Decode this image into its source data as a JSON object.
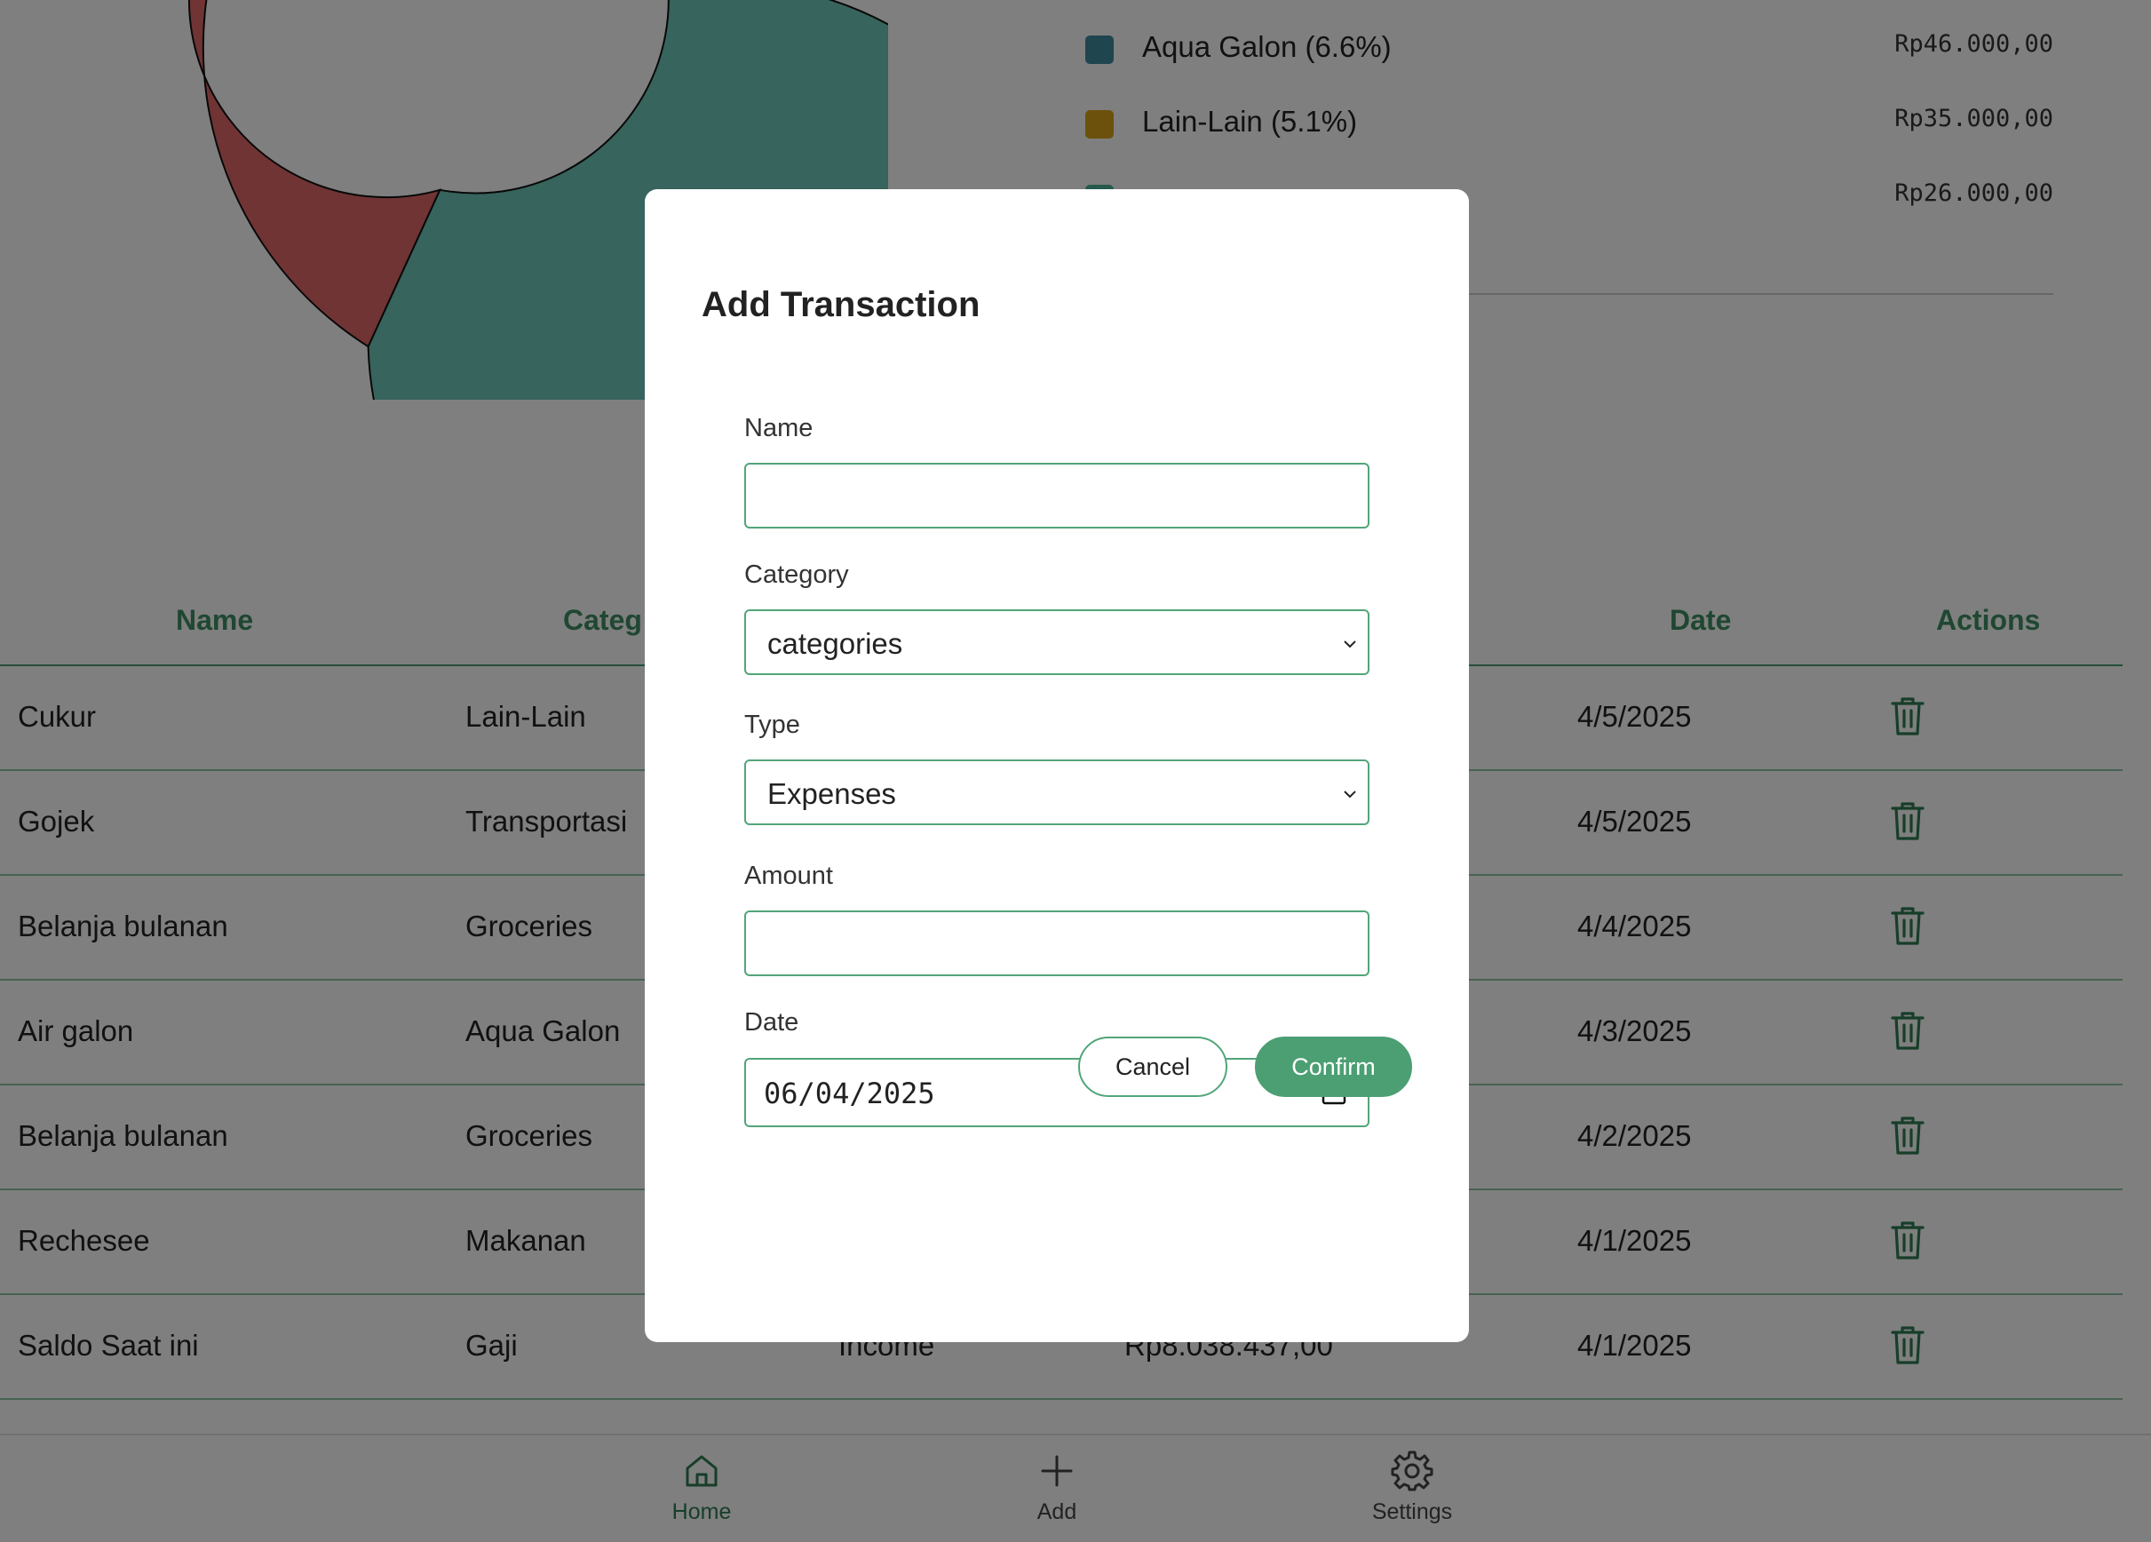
{
  "legend": [
    {
      "label": "Aqua Galon (6.6%)",
      "amount": "Rp46.000,00",
      "color": "#3e8a9f"
    },
    {
      "label": "Lain-Lain (5.1%)",
      "amount": "Rp35.000,00",
      "color": "#d9a21b"
    },
    {
      "label": "",
      "amount": "Rp26.000,00",
      "color": "#4bb59a"
    }
  ],
  "table": {
    "headers": {
      "name": "Name",
      "category": "Categ",
      "date": "Date",
      "actions": "Actions"
    },
    "rows": [
      {
        "name": "Cukur",
        "category": "Lain-Lain",
        "type": "",
        "amount": "",
        "date": "4/5/2025"
      },
      {
        "name": "Gojek",
        "category": "Transportasi",
        "type": "",
        "amount": "",
        "date": "4/5/2025"
      },
      {
        "name": "Belanja bulanan",
        "category": "Groceries",
        "type": "",
        "amount": "",
        "date": "4/4/2025"
      },
      {
        "name": "Air galon",
        "category": "Aqua Galon",
        "type": "",
        "amount": "",
        "date": "4/3/2025"
      },
      {
        "name": "Belanja bulanan",
        "category": "Groceries",
        "type": "",
        "amount": "",
        "date": "4/2/2025"
      },
      {
        "name": "Rechesee",
        "category": "Makanan",
        "type": "",
        "amount": "",
        "date": "4/1/2025"
      },
      {
        "name": "Saldo Saat ini",
        "category": "Gaji",
        "type": "Income",
        "amount": "Rp8.038.437,00",
        "date": "4/1/2025"
      }
    ]
  },
  "nav": {
    "home": "Home",
    "add": "Add",
    "settings": "Settings"
  },
  "modal": {
    "title": "Add Transaction",
    "name_label": "Name",
    "name_value": "",
    "category_label": "Category",
    "category_value": "categories",
    "type_label": "Type",
    "type_value": "Expenses",
    "amount_label": "Amount",
    "amount_value": "",
    "date_label": "Date",
    "date_value": "06/04/2025",
    "cancel_label": "Cancel",
    "confirm_label": "Confirm"
  },
  "colors": {
    "accent": "#4c9f73",
    "header_text": "#3e8f63",
    "donut_red": "#d85f5f",
    "donut_teal": "#6fc9b9"
  }
}
